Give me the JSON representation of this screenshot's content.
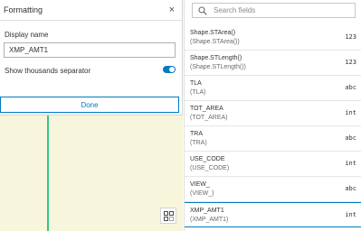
{
  "formatting": {
    "title": "Formatting",
    "close_glyph": "×",
    "display_name_label": "Display name",
    "display_name_value": "XMP_AMT1",
    "thousands_label": "Show thousands separator",
    "thousands_enabled": true,
    "done_label": "Done"
  },
  "search": {
    "placeholder": "Search fields"
  },
  "fields": [
    {
      "name": "Shape.STArea()",
      "alias": "(Shape.STArea())",
      "type": "123"
    },
    {
      "name": "Shape.STLength()",
      "alias": "(Shape.STLength())",
      "type": "123"
    },
    {
      "name": "TLA",
      "alias": "(TLA)",
      "type": "abc"
    },
    {
      "name": "TOT_AREA",
      "alias": "(TOT_AREA)",
      "type": "int"
    },
    {
      "name": "TRA",
      "alias": "(TRA)",
      "type": "abc"
    },
    {
      "name": "USE_CODE",
      "alias": "(USE_CODE)",
      "type": "int"
    },
    {
      "name": "VIEW_",
      "alias": "(VIEW_)",
      "type": "abc"
    },
    {
      "name": "XMP_AMT1",
      "alias": "(XMP_AMT1)",
      "type": "int"
    }
  ],
  "selected_field": "XMP_AMT1",
  "colors": {
    "accent": "#007ac2",
    "map_background": "#f7f5dc",
    "map_line": "#35c58a"
  },
  "icons": {
    "close": "close-icon",
    "search": "search-icon",
    "map_tool": "grid-select-icon"
  }
}
